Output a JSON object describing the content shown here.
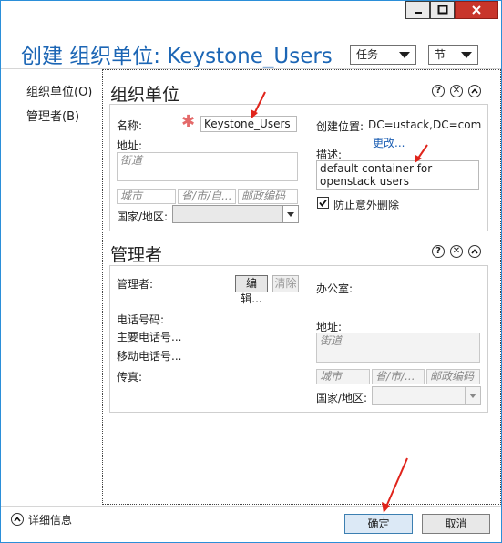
{
  "window": {
    "title": "创建 组织单位: Keystone_Users"
  },
  "header": {
    "tasks_label": "任务",
    "sections_label": "节"
  },
  "sidebar": {
    "items": [
      {
        "label": "组织单位(O)"
      },
      {
        "label": "管理者(B)"
      }
    ]
  },
  "ou_section": {
    "title": "组织单位",
    "name_label": "名称:",
    "name_value": "Keystone_Users",
    "create_in_label": "创建位置:",
    "create_in_value": "DC=ustack,DC=com",
    "change_link": "更改...",
    "address_label": "地址:",
    "street_placeholder": "街道",
    "city_placeholder": "城市",
    "state_placeholder": "省/市/自...",
    "zip_placeholder": "邮政编码",
    "country_label": "国家/地区:",
    "description_label": "描述:",
    "description_value": "default container for openstack users",
    "protect_label": "防止意外删除",
    "protect_checked": true
  },
  "manager_section": {
    "title": "管理者",
    "manager_label": "管理者:",
    "edit_label": "编辑...",
    "clear_label": "清除",
    "phone_label": "电话号码:",
    "main_phone_label": "主要电话号...",
    "mobile_label": "移动电话号...",
    "fax_label": "传真:",
    "office_label": "办公室:",
    "address_label": "地址:",
    "street_placeholder": "街道",
    "city_placeholder": "城市",
    "state_placeholder": "省/市/...",
    "zip_placeholder": "邮政编码",
    "country_label": "国家/地区:"
  },
  "footer": {
    "details_label": "详细信息",
    "ok_label": "确定",
    "cancel_label": "取消"
  },
  "colors": {
    "title_blue": "#1c66b5",
    "close_red": "#c8352b",
    "annotation_red": "#e0241b"
  }
}
